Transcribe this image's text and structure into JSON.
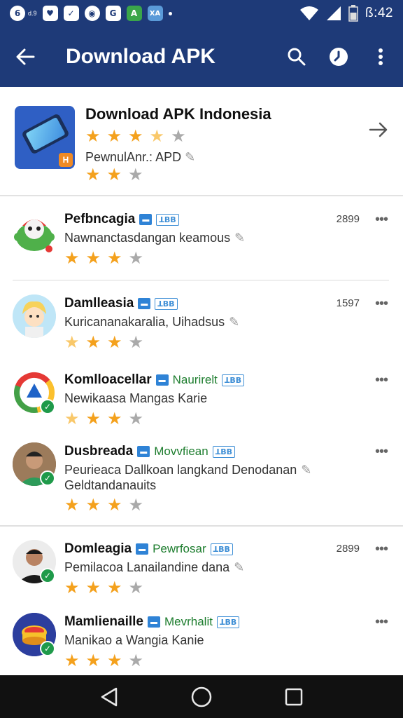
{
  "status_bar": {
    "time": "ß:42",
    "left_icons": [
      {
        "icon": "status-circle-icon",
        "glyph": "6"
      },
      {
        "icon": "status-heart-icon",
        "glyph": "♥"
      },
      {
        "icon": "status-check-icon",
        "glyph": "✓"
      },
      {
        "icon": "status-record-icon",
        "glyph": "◉"
      },
      {
        "icon": "status-g-icon",
        "glyph": "G"
      },
      {
        "icon": "status-a-icon",
        "glyph": "A"
      },
      {
        "icon": "status-xa-icon",
        "glyph": "XA"
      }
    ],
    "small_label": "d.9"
  },
  "app_bar": {
    "title": "Download APK",
    "actions": [
      "search-icon",
      "clock-icon",
      "more-vert-icon"
    ]
  },
  "featured": {
    "title": "Download APK Indonesia",
    "subtitle": "PewnulAnr.: APD",
    "rating_top": [
      1,
      1,
      1,
      0.5,
      0
    ],
    "rating_bottom": [
      1,
      1,
      0
    ],
    "badge_label": "H"
  },
  "apps": [
    {
      "name": "Pefbncagia",
      "tag_label": "",
      "tag_box": "ꓕꓐꓐ",
      "desc": "Nawnanctasdangan keamous",
      "desc2": "",
      "count": "2899",
      "rating": [
        1,
        1,
        1,
        0
      ],
      "avatar": "robot",
      "verified": false
    },
    {
      "name": "Damlleasia",
      "tag_label": "",
      "tag_box": "ꓕꓐꓐ",
      "desc": "Kuricananakaralia, Uihadsus",
      "desc2": "",
      "count": "1597",
      "rating": [
        0.5,
        1,
        1,
        0
      ],
      "avatar": "cartoon",
      "verified": false
    },
    {
      "name": "Komlloacellar",
      "tag_label": "Naurirelt",
      "tag_box": "ꓕꓐꓐ",
      "desc": "Newikaasa Mangas Karie",
      "desc2": "",
      "count": "",
      "rating": [
        0.5,
        1,
        1,
        0
      ],
      "avatar": "chrome",
      "verified": true
    },
    {
      "name": "Dusbreada",
      "tag_label": "Movvfiean",
      "tag_box": "ꓕꓐꓐ",
      "desc": "Peurieaca Dallkoan langkand Denodanan",
      "desc2": "Geldtandanauits",
      "count": "",
      "rating": [
        1,
        1,
        1,
        0
      ],
      "avatar": "person1",
      "verified": true
    },
    {
      "name": "Domleagia",
      "tag_label": "Pewrfosar",
      "tag_box": "ꓕꓐꓐ",
      "desc": "Pemilacoa Lanailandine dana",
      "desc2": "",
      "count": "2899",
      "rating": [
        1,
        1,
        1,
        0
      ],
      "avatar": "person2",
      "verified": true
    },
    {
      "name": "Mamlienaille",
      "tag_label": "Mevrhalit",
      "tag_box": "ꓕꓐꓐ",
      "desc": "Manikao a Wangia Kanie",
      "desc2": "",
      "count": "",
      "rating": [
        1,
        1,
        1,
        0
      ],
      "avatar": "drum",
      "verified": true
    }
  ],
  "nav_bar": [
    "back-triangle-icon",
    "home-circle-icon",
    "recents-square-icon"
  ],
  "colors": {
    "primary": "#1e3a78",
    "star": "#f4a11d",
    "tag_green": "#1d7d2e",
    "tag_blue": "#2f83d6"
  }
}
